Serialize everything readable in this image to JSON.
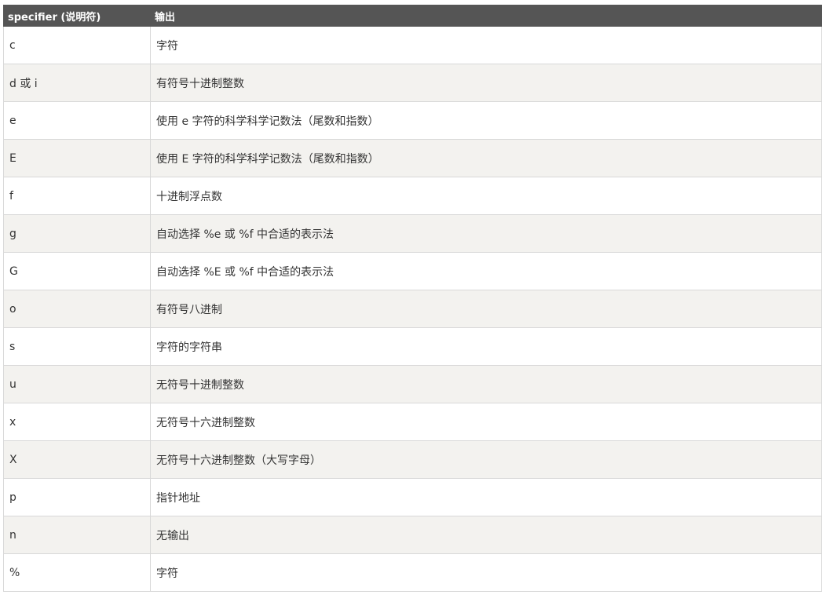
{
  "table": {
    "headers": [
      "specifier (说明符)",
      "输出"
    ],
    "rows": [
      {
        "specifier": "c",
        "output": "字符"
      },
      {
        "specifier": "d 或 i",
        "output": "有符号十进制整数"
      },
      {
        "specifier": "e",
        "output": "使用 e 字符的科学科学记数法（尾数和指数）"
      },
      {
        "specifier": "E",
        "output": "使用 E 字符的科学科学记数法（尾数和指数）"
      },
      {
        "specifier": "f",
        "output": "十进制浮点数"
      },
      {
        "specifier": "g",
        "output": "自动选择 %e 或 %f 中合适的表示法"
      },
      {
        "specifier": "G",
        "output": "自动选择 %E 或 %f 中合适的表示法"
      },
      {
        "specifier": "o",
        "output": "有符号八进制"
      },
      {
        "specifier": "s",
        "output": "字符的字符串"
      },
      {
        "specifier": "u",
        "output": "无符号十进制整数"
      },
      {
        "specifier": "x",
        "output": "无符号十六进制整数"
      },
      {
        "specifier": "X",
        "output": "无符号十六进制整数（大写字母）"
      },
      {
        "specifier": "p",
        "output": "指针地址"
      },
      {
        "specifier": "n",
        "output": "无输出"
      },
      {
        "specifier": "%",
        "output": "字符"
      }
    ]
  },
  "colors": {
    "header_bg": "#555555",
    "header_text": "#ffffff",
    "row_alt_bg": "#f3f2ef",
    "border": "#d8d8d8"
  }
}
